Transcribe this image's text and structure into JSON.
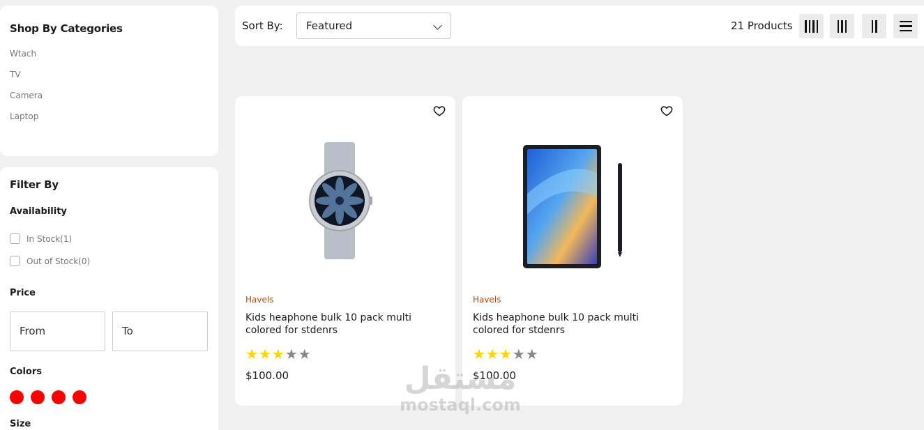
{
  "sidebar": {
    "categories_title": "Shop By Categories",
    "categories": [
      "Wtach",
      "TV",
      "Camera",
      "Laptop"
    ],
    "filter_title": "Filter By",
    "availability_title": "Availability",
    "availability": [
      "In Stock(1)",
      "Out of Stock(0)"
    ],
    "price_title": "Price",
    "price_from_placeholder": "From",
    "price_to_placeholder": "To",
    "colors_title": "Colors",
    "colors": [
      "#ff0000",
      "#ff0000",
      "#ff0000",
      "#ff0000"
    ],
    "size_title": "Size"
  },
  "toolbar": {
    "sort_label": "Sort By:",
    "sort_value": "Featured",
    "product_count": "21 Products",
    "grid_buttons": [
      "grid-4-icon",
      "grid-3-icon",
      "grid-2-icon",
      "list-icon"
    ]
  },
  "products": [
    {
      "brand": "Havels",
      "name": "Kids heaphone bulk 10 pack multi colored for stdenrs",
      "rating": 3,
      "max_rating": 5,
      "price": "$100.00",
      "image": "smartwatch"
    },
    {
      "brand": "Havels",
      "name": "Kids heaphone bulk 10 pack multi colored for stdenrs",
      "rating": 3,
      "max_rating": 5,
      "price": "$100.00",
      "image": "tablet-with-stylus"
    }
  ],
  "watermark": {
    "arabic": "مستقل",
    "latin": "mostaql.com"
  }
}
